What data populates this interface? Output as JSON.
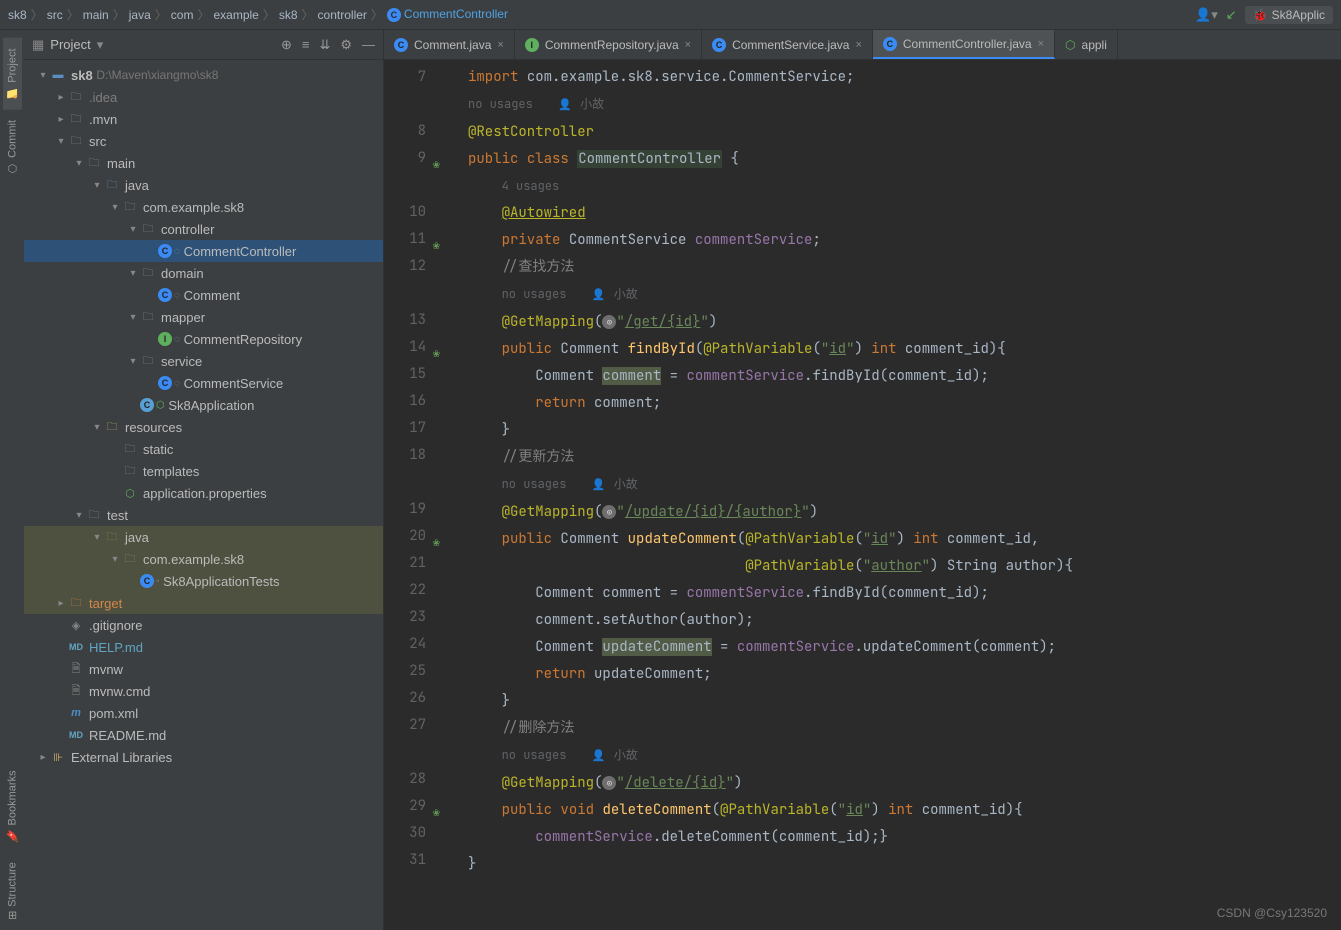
{
  "breadcrumb": [
    "sk8",
    "src",
    "main",
    "java",
    "com",
    "example",
    "sk8",
    "controller"
  ],
  "breadcrumb_class": "CommentController",
  "run_config": "Sk8Applic",
  "sidebar": {
    "title": "Project",
    "root": "sk8",
    "root_path": "D:\\Maven\\xiangmo\\sk8",
    "idea": ".idea",
    "mvn": ".mvn",
    "src": "src",
    "main_f": "main",
    "java_f": "java",
    "pkg": "com.example.sk8",
    "controller": "controller",
    "comment_controller": "CommentController",
    "domain": "domain",
    "comment_cls": "Comment",
    "mapper": "mapper",
    "comment_repo": "CommentRepository",
    "service": "service",
    "comment_service": "CommentService",
    "sk8_app": "Sk8Application",
    "resources": "resources",
    "static_f": "static",
    "templates": "templates",
    "app_props": "application.properties",
    "test": "test",
    "test_java": "java",
    "test_pkg": "com.example.sk8",
    "sk8_tests": "Sk8ApplicationTests",
    "target": "target",
    "gitignore": ".gitignore",
    "helpmd": "HELP.md",
    "mvnw": "mvnw",
    "mvnwcmd": "mvnw.cmd",
    "pom": "pom.xml",
    "readme": "README.md",
    "ext_libs": "External Libraries"
  },
  "tabs": [
    {
      "label": "Comment.java",
      "icon": "c",
      "active": false
    },
    {
      "label": "CommentRepository.java",
      "icon": "i",
      "active": false
    },
    {
      "label": "CommentService.java",
      "icon": "c",
      "active": false
    },
    {
      "label": "CommentController.java",
      "icon": "c",
      "active": true
    },
    {
      "label": "appli",
      "icon": "s",
      "active": false
    }
  ],
  "rail": {
    "project": "Project",
    "commit": "Commit",
    "bookmarks": "Bookmarks",
    "structure": "Structure"
  },
  "code": {
    "import_line": {
      "kw": "import",
      "pkg": "com.example.sk8.service.CommentService",
      "semi": ";"
    },
    "no_usages": "no usages",
    "author": "小故",
    "usages4": "4 usages",
    "rest": "@RestController",
    "public": "public",
    "class": "class",
    "cls_name": "CommentController",
    "autowired": "@Autowired",
    "private": "private",
    "svc_type": "CommentService",
    "svc_field": "commentService",
    "cmt_find": "//查找方法",
    "getmapping": "@GetMapping",
    "path_get": "/get/{id}",
    "comment_type": "Comment",
    "findbyid": "findById",
    "pathvar": "@PathVariable",
    "id": "id",
    "int": "int",
    "cid": "comment_id",
    "comment_var": "comment",
    "return": "return",
    "cmt_update": "//更新方法",
    "path_update": "/update/{id}/{author}",
    "update_fn": "updateComment",
    "author_str": "author",
    "string_t": "String",
    "author_p": "author",
    "setauthor": "setAuthor",
    "cmt_delete": "//删除方法",
    "path_delete": "/delete/{id}",
    "void": "void",
    "delete_fn": "deleteComment"
  },
  "line_numbers": [
    7,
    8,
    9,
    10,
    11,
    12,
    13,
    14,
    15,
    16,
    17,
    18,
    19,
    20,
    21,
    22,
    23,
    24,
    25,
    26,
    27,
    28,
    29,
    30,
    31
  ],
  "watermark": "CSDN @Csy123520"
}
